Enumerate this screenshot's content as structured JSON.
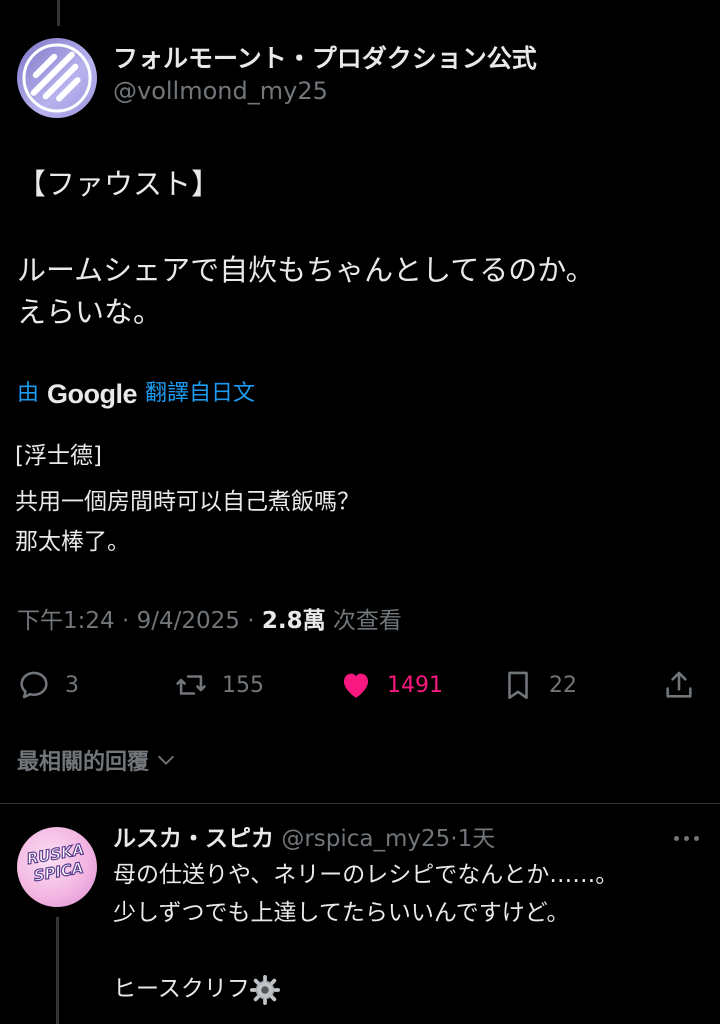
{
  "post": {
    "display_name": "フォルモーント・プロダクション公式",
    "handle": "@vollmond_my25",
    "lines": [
      "【ファウスト】",
      "ルームシェアで自炊もちゃんとしてるのか。",
      "えらいな。"
    ],
    "translation": {
      "by": "由",
      "provider": "Google",
      "from": "翻譯自日文",
      "lines": [
        "[浮士德]",
        "共用一個房間時可以自己煮飯嗎？",
        "那太棒了。"
      ]
    },
    "time": "下午1:24",
    "sep1": "·",
    "date": "9/4/2025",
    "sep2": "·",
    "views_count": "2.8萬",
    "views_label": "次查看",
    "actions": {
      "replies": "3",
      "reposts": "155",
      "likes": "1491",
      "bookmarks": "22"
    },
    "like_color": "#f91880"
  },
  "replies_sort": "最相關的回覆",
  "reply": {
    "display_name": "ルスカ・スピカ",
    "handle": "@rspica_my25",
    "dot": "·",
    "age": "1天",
    "avatar_text": "RUSKA SPICA",
    "lines": [
      "母の仕送りや、ネリーのレシピでなんとか……。",
      "少しずつでも上達してたらいいんですけど。",
      "",
      "ヒースクリフ"
    ]
  }
}
